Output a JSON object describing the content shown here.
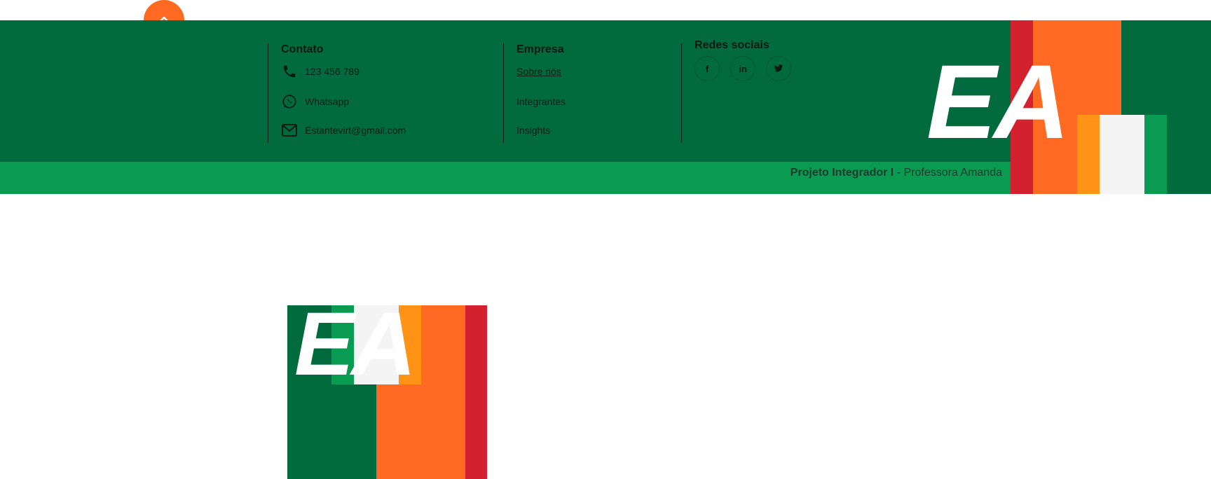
{
  "footer": {
    "contact": {
      "title": "Contato",
      "phone": "123 456 789",
      "whatsapp": "Whatsapp",
      "email": "Estantevirt@gmail.com"
    },
    "company": {
      "title": "Empresa",
      "links": [
        "Sobre nós",
        "Integrantes",
        "Insights"
      ]
    },
    "social": {
      "title": "Redes sociais",
      "icons": [
        {
          "name": "facebook-icon",
          "glyph": "f"
        },
        {
          "name": "linkedin-icon",
          "glyph": "in"
        },
        {
          "name": "twitter-icon",
          "glyph": "tw"
        }
      ]
    },
    "logo_text": "EA",
    "credits": {
      "bold": "Projeto Integrador I",
      "rest": " - Professora Amanda"
    }
  },
  "hero_logo": {
    "text": "EA"
  },
  "colors": {
    "dark_green": "#016b3d",
    "green": "#0a9b52",
    "orange": "#fe6a22",
    "red": "#d4212f",
    "amber": "#fe9316",
    "white_stripe": "#f4f4f4"
  },
  "icons": {
    "scroll_top": "chevron-up-icon",
    "phone": "phone-icon",
    "whatsapp": "whatsapp-icon",
    "email": "mail-icon"
  }
}
